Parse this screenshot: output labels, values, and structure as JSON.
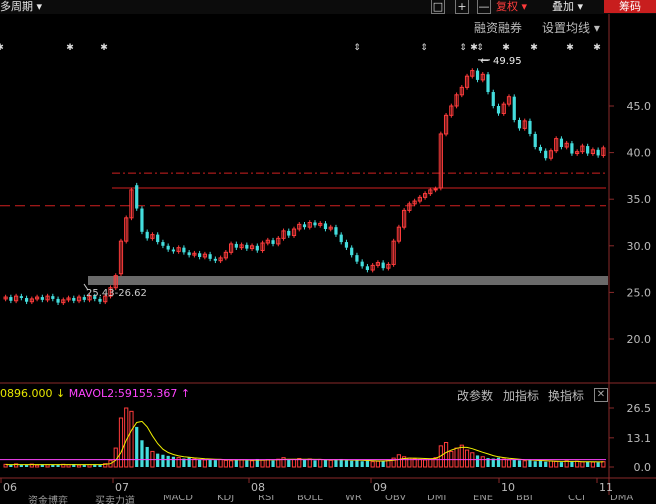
{
  "toolbar": {
    "period_label": "多周期 ▾",
    "btn_a": "□",
    "btn_b": "+",
    "btn_c": "—",
    "fuquan": "复权 ▾",
    "diejia": "叠加 ▾",
    "chouma": "筹码"
  },
  "menu": {
    "margin": "融资融券",
    "ma_settings": "设置均线 ▾"
  },
  "price_axis": [
    "45.0",
    "40.0",
    "35.0",
    "30.0",
    "25.0",
    "20.0"
  ],
  "annotations": {
    "high": "49.95",
    "range": "25.43-26.62"
  },
  "volume_header": {
    "left": "0896.000",
    "arrow": "↓",
    "mavol2": "MAVOL2:59155.367",
    "arrow2": "↑"
  },
  "volume_buttons": {
    "params": "改参数",
    "add": "加指标",
    "swap": "换指标",
    "close": "✕"
  },
  "volume_axis": [
    "26.5",
    "13.1",
    "0.0"
  ],
  "months": [
    "06",
    "07",
    "08",
    "09",
    "10",
    "11"
  ],
  "tabs": [
    "资金博弈",
    "买卖力道",
    "MACD",
    "KDJ",
    "RSI",
    "BOLL",
    "WR",
    "OBV",
    "DMI",
    "ENE",
    "BBI",
    "CCI",
    "DMA"
  ],
  "chart_data": {
    "type": "candlestick",
    "price_range": [
      16,
      53
    ],
    "volume_range": [
      0,
      26.5
    ],
    "highlighted_high": 49.95,
    "support_band": [
      25.43,
      26.62
    ],
    "reference_lines": [
      37.8,
      36.2,
      34.3
    ],
    "series": [
      {
        "o": 24.3,
        "c": 24.5
      },
      {
        "o": 24.5,
        "c": 24.1
      },
      {
        "o": 24.1,
        "c": 24.6
      },
      {
        "o": 24.6,
        "c": 24.4
      },
      {
        "o": 24.4,
        "c": 24.0
      },
      {
        "o": 24.0,
        "c": 24.3
      },
      {
        "o": 24.3,
        "c": 24.5
      },
      {
        "o": 24.5,
        "c": 24.2
      },
      {
        "o": 24.2,
        "c": 24.6
      },
      {
        "o": 24.6,
        "c": 24.3
      },
      {
        "o": 24.3,
        "c": 23.9
      },
      {
        "o": 23.9,
        "c": 24.2
      },
      {
        "o": 24.2,
        "c": 24.4
      },
      {
        "o": 24.4,
        "c": 24.1
      },
      {
        "o": 24.1,
        "c": 24.5
      },
      {
        "o": 24.5,
        "c": 24.2
      },
      {
        "o": 24.2,
        "c": 24.6
      },
      {
        "o": 24.6,
        "c": 24.3
      },
      {
        "o": 24.3,
        "c": 24.0
      },
      {
        "o": 24.0,
        "c": 24.6
      },
      {
        "o": 24.6,
        "c": 25.5
      },
      {
        "o": 25.5,
        "c": 26.8
      },
      {
        "o": 27.0,
        "c": 30.5
      },
      {
        "o": 30.5,
        "c": 33.0
      },
      {
        "o": 33.0,
        "c": 36.0
      },
      {
        "o": 36.5,
        "c": 34.0
      },
      {
        "o": 34.0,
        "c": 31.5
      },
      {
        "o": 31.5,
        "c": 30.8
      },
      {
        "o": 30.8,
        "c": 31.2
      },
      {
        "o": 31.2,
        "c": 30.4
      },
      {
        "o": 30.4,
        "c": 30.0
      },
      {
        "o": 30.0,
        "c": 29.6
      },
      {
        "o": 29.6,
        "c": 29.4
      },
      {
        "o": 29.4,
        "c": 29.8
      },
      {
        "o": 29.8,
        "c": 29.3
      },
      {
        "o": 29.3,
        "c": 29.0
      },
      {
        "o": 29.0,
        "c": 29.2
      },
      {
        "o": 29.2,
        "c": 28.8
      },
      {
        "o": 28.8,
        "c": 29.1
      },
      {
        "o": 29.1,
        "c": 28.6
      },
      {
        "o": 28.6,
        "c": 28.4
      },
      {
        "o": 28.4,
        "c": 28.7
      },
      {
        "o": 28.7,
        "c": 29.3
      },
      {
        "o": 29.3,
        "c": 30.2
      },
      {
        "o": 30.2,
        "c": 29.8
      },
      {
        "o": 29.8,
        "c": 30.1
      },
      {
        "o": 30.1,
        "c": 29.7
      },
      {
        "o": 29.7,
        "c": 30.0
      },
      {
        "o": 30.0,
        "c": 29.5
      },
      {
        "o": 29.5,
        "c": 30.3
      },
      {
        "o": 30.3,
        "c": 30.6
      },
      {
        "o": 30.6,
        "c": 30.2
      },
      {
        "o": 30.2,
        "c": 30.8
      },
      {
        "o": 30.8,
        "c": 31.6
      },
      {
        "o": 31.6,
        "c": 31.1
      },
      {
        "o": 31.1,
        "c": 31.8
      },
      {
        "o": 31.8,
        "c": 32.3
      },
      {
        "o": 32.3,
        "c": 32.0
      },
      {
        "o": 32.0,
        "c": 32.5
      },
      {
        "o": 32.5,
        "c": 32.2
      },
      {
        "o": 32.2,
        "c": 32.4
      },
      {
        "o": 32.4,
        "c": 31.8
      },
      {
        "o": 31.8,
        "c": 32.0
      },
      {
        "o": 32.0,
        "c": 31.2
      },
      {
        "o": 31.2,
        "c": 30.4
      },
      {
        "o": 30.4,
        "c": 29.8
      },
      {
        "o": 29.8,
        "c": 29.0
      },
      {
        "o": 29.0,
        "c": 28.3
      },
      {
        "o": 28.3,
        "c": 27.8
      },
      {
        "o": 27.8,
        "c": 27.4
      },
      {
        "o": 27.4,
        "c": 27.9
      },
      {
        "o": 27.9,
        "c": 28.2
      },
      {
        "o": 28.2,
        "c": 27.6
      },
      {
        "o": 27.6,
        "c": 28.0
      },
      {
        "o": 28.0,
        "c": 30.5
      },
      {
        "o": 30.5,
        "c": 32.0
      },
      {
        "o": 32.0,
        "c": 33.8
      },
      {
        "o": 33.8,
        "c": 34.5
      },
      {
        "o": 34.5,
        "c": 34.8
      },
      {
        "o": 34.8,
        "c": 35.2
      },
      {
        "o": 35.2,
        "c": 35.6
      },
      {
        "o": 35.6,
        "c": 36.0
      },
      {
        "o": 36.0,
        "c": 36.1
      },
      {
        "o": 36.2,
        "c": 42.0
      },
      {
        "o": 42.0,
        "c": 44.0
      },
      {
        "o": 44.0,
        "c": 45.0
      },
      {
        "o": 45.0,
        "c": 46.2
      },
      {
        "o": 46.2,
        "c": 47.0
      },
      {
        "o": 47.0,
        "c": 48.2
      },
      {
        "o": 48.2,
        "c": 48.8
      },
      {
        "o": 48.8,
        "c": 47.8
      },
      {
        "o": 47.8,
        "c": 48.4
      },
      {
        "o": 48.4,
        "c": 46.5
      },
      {
        "o": 46.5,
        "c": 45.0
      },
      {
        "o": 45.0,
        "c": 44.2
      },
      {
        "o": 44.2,
        "c": 45.2
      },
      {
        "o": 45.2,
        "c": 46.0
      },
      {
        "o": 46.0,
        "c": 43.5
      },
      {
        "o": 43.5,
        "c": 42.6
      },
      {
        "o": 42.6,
        "c": 43.4
      },
      {
        "o": 43.4,
        "c": 42.0
      },
      {
        "o": 42.0,
        "c": 40.6
      },
      {
        "o": 40.6,
        "c": 40.2
      },
      {
        "o": 40.2,
        "c": 39.4
      },
      {
        "o": 39.4,
        "c": 40.2
      },
      {
        "o": 40.2,
        "c": 41.5
      },
      {
        "o": 41.5,
        "c": 40.6
      },
      {
        "o": 40.6,
        "c": 41.0
      },
      {
        "o": 41.0,
        "c": 39.9
      },
      {
        "o": 39.9,
        "c": 40.1
      },
      {
        "o": 40.1,
        "c": 40.7
      },
      {
        "o": 40.7,
        "c": 39.9
      },
      {
        "o": 39.9,
        "c": 40.3
      },
      {
        "o": 40.3,
        "c": 39.7
      },
      {
        "o": 39.7,
        "c": 40.5
      }
    ],
    "volumes": [
      1.2,
      1.0,
      1.4,
      0.9,
      1.1,
      1.3,
      0.8,
      1.2,
      1.0,
      1.1,
      0.9,
      1.2,
      1.0,
      1.3,
      0.8,
      1.1,
      1.0,
      1.2,
      0.9,
      1.5,
      3.0,
      8.5,
      22.0,
      26.5,
      25.0,
      18.0,
      12.0,
      9.0,
      7.0,
      6.0,
      5.5,
      5.0,
      4.6,
      4.2,
      3.8,
      4.5,
      3.6,
      3.4,
      3.2,
      3.6,
      3.1,
      3.4,
      3.0,
      2.8,
      3.4,
      3.2,
      3.0,
      2.8,
      3.6,
      3.1,
      3.3,
      2.9,
      3.5,
      4.2,
      3.6,
      3.4,
      3.8,
      3.2,
      3.6,
      3.0,
      3.4,
      3.2,
      3.0,
      3.4,
      3.6,
      3.0,
      2.8,
      3.2,
      2.6,
      2.8,
      2.4,
      2.6,
      2.9,
      3.2,
      4.0,
      5.5,
      4.6,
      4.0,
      3.6,
      3.4,
      3.2,
      3.6,
      4.2,
      9.5,
      11.0,
      7.0,
      8.5,
      9.8,
      7.6,
      6.4,
      5.2,
      4.6,
      4.0,
      3.8,
      4.2,
      3.6,
      3.2,
      3.4,
      3.0,
      2.8,
      3.1,
      2.6,
      2.8,
      2.4,
      2.7,
      2.5,
      2.2,
      2.8,
      2.4,
      2.6,
      2.3,
      2.5,
      2.2,
      2.1,
      2.4
    ],
    "vol_ma": [
      1.1,
      1.1,
      1.1,
      1.1,
      1.1,
      1.1,
      1.1,
      1.1,
      1.1,
      1.1,
      1.1,
      1.1,
      1.1,
      1.1,
      1.1,
      1.1,
      1.1,
      1.1,
      1.1,
      1.2,
      1.5,
      3.0,
      6.5,
      12.0,
      16.5,
      20.0,
      20.5,
      18.0,
      14.0,
      10.5,
      8.0,
      6.5,
      5.6,
      5.0,
      4.6,
      4.4,
      4.1,
      3.9,
      3.7,
      3.6,
      3.5,
      3.4,
      3.3,
      3.3,
      3.2,
      3.2,
      3.2,
      3.1,
      3.1,
      3.1,
      3.2,
      3.2,
      3.3,
      3.4,
      3.5,
      3.5,
      3.5,
      3.5,
      3.5,
      3.4,
      3.4,
      3.3,
      3.3,
      3.3,
      3.3,
      3.2,
      3.1,
      3.1,
      3.0,
      2.9,
      2.8,
      2.7,
      2.7,
      2.8,
      3.0,
      3.4,
      3.8,
      4.0,
      4.0,
      3.9,
      3.8,
      3.7,
      3.8,
      5.0,
      6.5,
      7.6,
      8.4,
      8.9,
      8.8,
      8.2,
      7.4,
      6.6,
      5.9,
      5.1,
      4.6,
      4.2,
      3.9,
      3.7,
      3.5,
      3.3,
      3.2,
      3.0,
      2.9,
      2.8,
      2.7,
      2.6,
      2.5,
      2.5,
      2.5,
      2.5,
      2.4,
      2.4,
      2.4,
      2.3,
      2.3
    ],
    "mavol2_line": 3.3
  }
}
